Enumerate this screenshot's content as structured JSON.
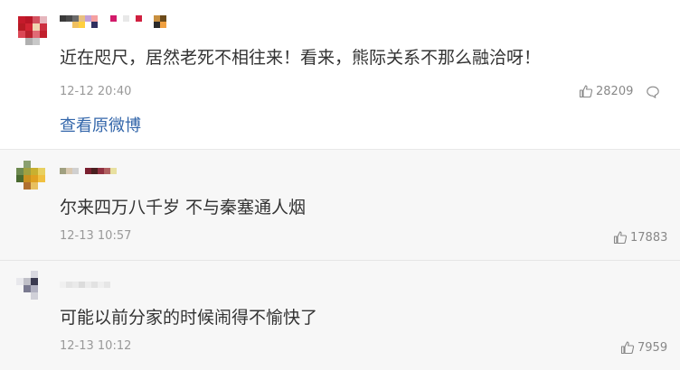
{
  "comments": [
    {
      "text": "近在咫尺，居然老死不相往来！看来，熊际关系不那么融洽呀！",
      "time": "12-12 20:40",
      "likes": "28209",
      "view_original": "查看原微博"
    },
    {
      "text": "尔来四万八千岁 不与秦塞通人烟",
      "time": "12-13 10:57",
      "likes": "17883"
    },
    {
      "text": "可能以前分家的时候闹得不愉快了",
      "time": "12-13 10:12",
      "likes": "7959"
    }
  ],
  "colors": {
    "text": "#333333",
    "meta": "#999999",
    "link": "#3366aa",
    "alt_background": "#f7f7f7"
  },
  "icons": [
    "thumb-up-icon",
    "reply-bubble-icon"
  ]
}
